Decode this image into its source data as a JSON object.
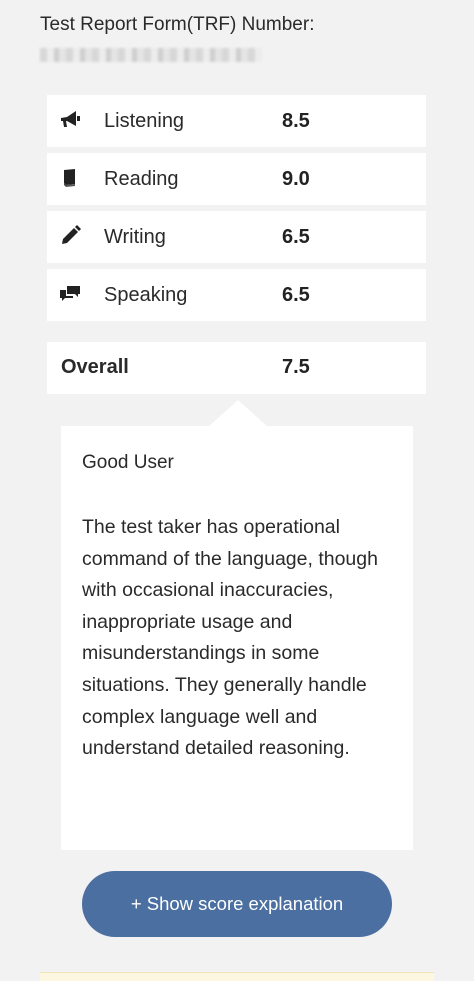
{
  "trf": {
    "label": "Test Report Form(TRF) Number:"
  },
  "scores": [
    {
      "icon": "megaphone-icon",
      "name": "Listening",
      "value": "8.5"
    },
    {
      "icon": "book-icon",
      "name": "Reading",
      "value": "9.0"
    },
    {
      "icon": "pencil-icon",
      "name": "Writing",
      "value": "6.5"
    },
    {
      "icon": "speech-bubbles-icon",
      "name": "Speaking",
      "value": "6.5"
    }
  ],
  "overall": {
    "name": "Overall",
    "value": "7.5"
  },
  "explanation": {
    "band_title": "Good User",
    "description": "The test taker has operational command of the language, though with occasional inaccuracies, inappropriate usage and misunderstandings in some situations. They generally handle complex language well and understand detailed reasoning."
  },
  "button": {
    "label": "+ Show score explanation"
  },
  "colors": {
    "accent": "#4a6fa0",
    "background": "#f2f2f2"
  }
}
